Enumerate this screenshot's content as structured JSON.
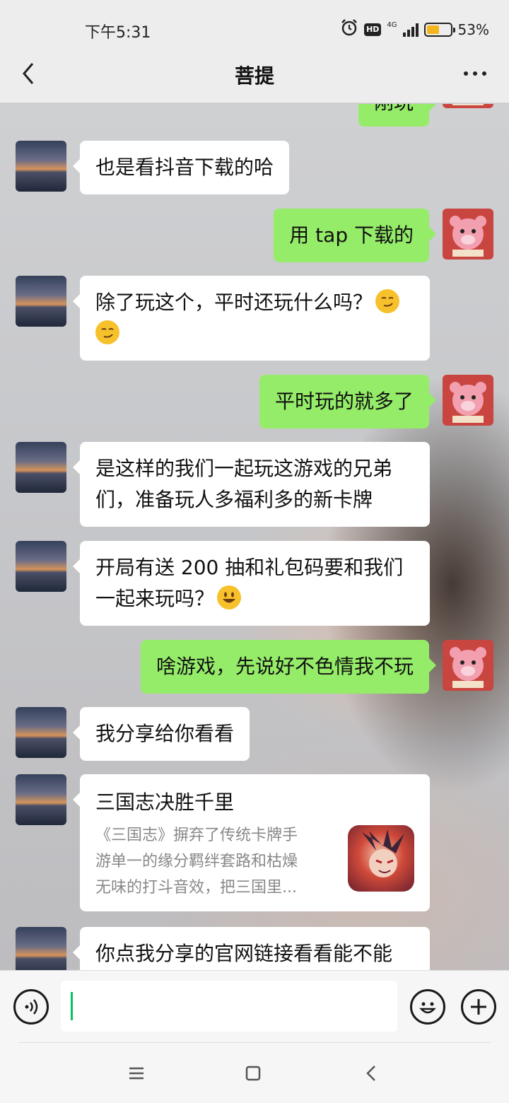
{
  "status_bar": {
    "time": "下午5:31",
    "hd": "HD",
    "network": "4G",
    "battery": "53%",
    "battery_level": 0.53
  },
  "header": {
    "title": "菩提"
  },
  "messages": [
    {
      "side": "right",
      "text": "刚玩"
    },
    {
      "side": "left",
      "text": "也是看抖音下载的哈"
    },
    {
      "side": "right",
      "text": "用 tap 下载的"
    },
    {
      "side": "left",
      "text_line1": "除了玩这个，平时还玩什么吗？",
      "emoji": "smirk-emoji"
    },
    {
      "side": "right",
      "text": "平时玩的就多了"
    },
    {
      "side": "left",
      "text_line1": "是这样的我们一起玩这游戏的兄弟",
      "text_line2": "们，准备玩人多福利多的新卡牌"
    },
    {
      "side": "left",
      "text_line1": "开局有送 200 抽和礼包码要和我们",
      "text_line2": "一起来玩吗？",
      "emoji": "grin-emoji"
    },
    {
      "side": "right",
      "text": "啥游戏，先说好不色情我不玩"
    },
    {
      "side": "left",
      "text": "我分享给你看看"
    },
    {
      "side": "left",
      "type": "share_card",
      "title": "三国志决胜千里",
      "desc_line1": "《三国志》摒弃了传统卡牌手",
      "desc_line2": "游单一的缘分羁绊套路和枯燥",
      "desc_line3": "无味的打斗音效，把三国里..."
    },
    {
      "side": "left",
      "text": "你点我分享的官网链接看看能不能"
    }
  ],
  "input_bar": {
    "value": ""
  },
  "icons": {
    "back": "back-chevron-icon",
    "more": "more-dots-icon",
    "voice": "voice-icon",
    "emoji": "emoji-smile-icon",
    "plus": "plus-icon",
    "alarm": "alarm-icon"
  }
}
